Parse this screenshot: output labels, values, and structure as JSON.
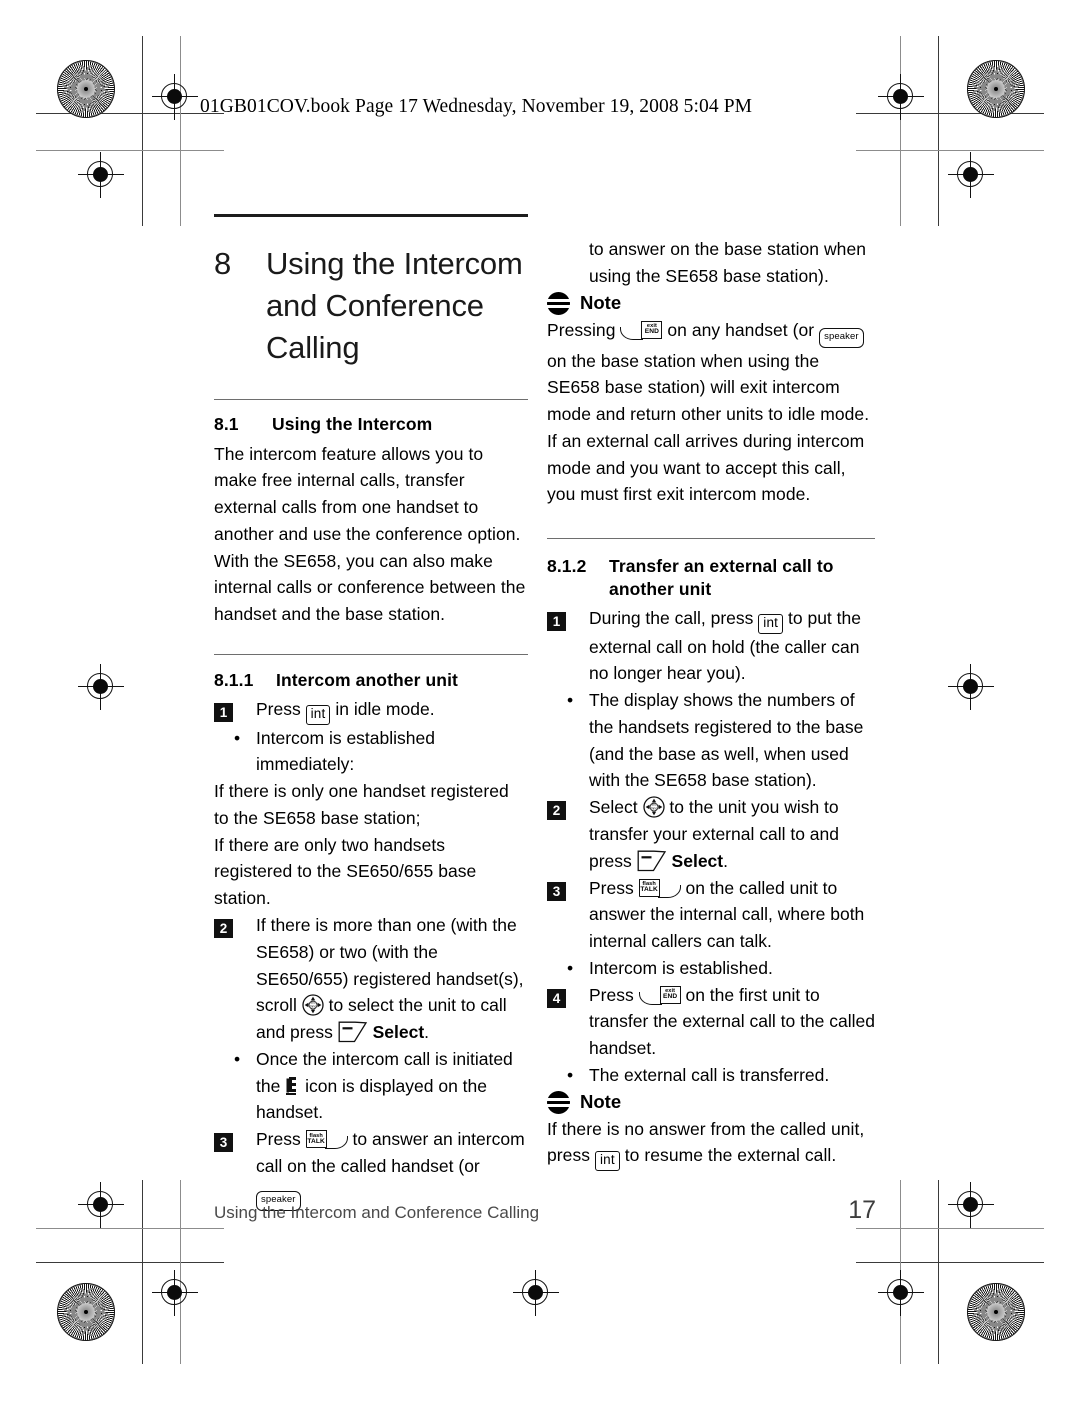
{
  "page_header": "01GB01COV.book  Page 17  Wednesday, November 19, 2008  5:04 PM",
  "chapter": {
    "number": "8",
    "title_lines": [
      "Using the Intercom",
      "and Conference",
      "Calling"
    ]
  },
  "sections": {
    "s81": {
      "number": "8.1",
      "title": "Using the Intercom",
      "paragraph": "The intercom feature allows you to make free internal calls, transfer external calls from one handset to another and use the conference option. With the SE658, you can also make internal calls or conference between the handset and the base station."
    },
    "s811": {
      "number": "8.1.1",
      "title": "Intercom another unit",
      "step1_pre": "Press",
      "step1_post": "in idle mode.",
      "step1_bullet": "Intercom is established immediately:",
      "step1_cond1": "If there is only one handset registered to the SE658 base station;",
      "step1_cond2": "If there are only two handsets registered to the SE650/655 base station.",
      "step2_a": "If there is more than one (with the SE658) or two (with the SE650/655) registered handset(s), scroll",
      "step2_b": "to select the unit to call and press",
      "step2_bold": "Select",
      "step2_end": ".",
      "step2_bullet_a": "Once the intercom call is initiated the",
      "step2_bullet_b": "icon is displayed on the handset.",
      "step3_pre": "Press",
      "step3_mid": "to answer an intercom call on the called handset (or",
      "step3_post": ""
    },
    "note1": {
      "label": "Note",
      "lead_in": "to answer on the base station when using the SE658 base station).",
      "a": "Pressing",
      "b": "on any handset (or",
      "c": "on the base station when using the SE658 base station) will exit intercom mode and return other units to idle mode. If an external call arrives during intercom mode and you want to accept this call, you must first exit intercom mode."
    },
    "s812": {
      "number": "8.1.2",
      "title_line1": "Transfer an external call to",
      "title_line2": "another unit",
      "step1_pre": "During the call, press",
      "step1_post": "to put the external call on hold (the caller can no longer hear you).",
      "step1_bullet": "The display shows the numbers of the handsets registered to the base (and the base as well, when used with the SE658 base station).",
      "step2_pre": "Select",
      "step2_mid": "to the unit you wish to transfer your external call to and press",
      "step2_bold": "Select",
      "step2_end": ".",
      "step3_pre": "Press",
      "step3_post": "on the called unit to answer the internal call, where both internal callers can talk.",
      "step3_bullet": "Intercom is established.",
      "step4_pre": "Press",
      "step4_post": "on the first unit to transfer the external call to the called handset.",
      "step4_bullet": "The external call is transferred."
    },
    "note2": {
      "label": "Note",
      "a": "If there is no answer from the called unit, press",
      "b": "to resume the external call."
    }
  },
  "keys": {
    "int": "int",
    "speaker": "speaker",
    "talk_line1": "flash",
    "talk_line2": "TALK",
    "end_line1": "exit",
    "end_line2": "END",
    "nav_up": "up",
    "nav_down": "down",
    "nav_labels": "a/b/c"
  },
  "footer": {
    "title": "Using the Intercom and Conference Calling",
    "page_number": "17"
  },
  "colors": {
    "ink": "#000000",
    "rule": "#6e6e6e",
    "footer_text": "#4a4a4a",
    "marker_bg": "#111111"
  }
}
